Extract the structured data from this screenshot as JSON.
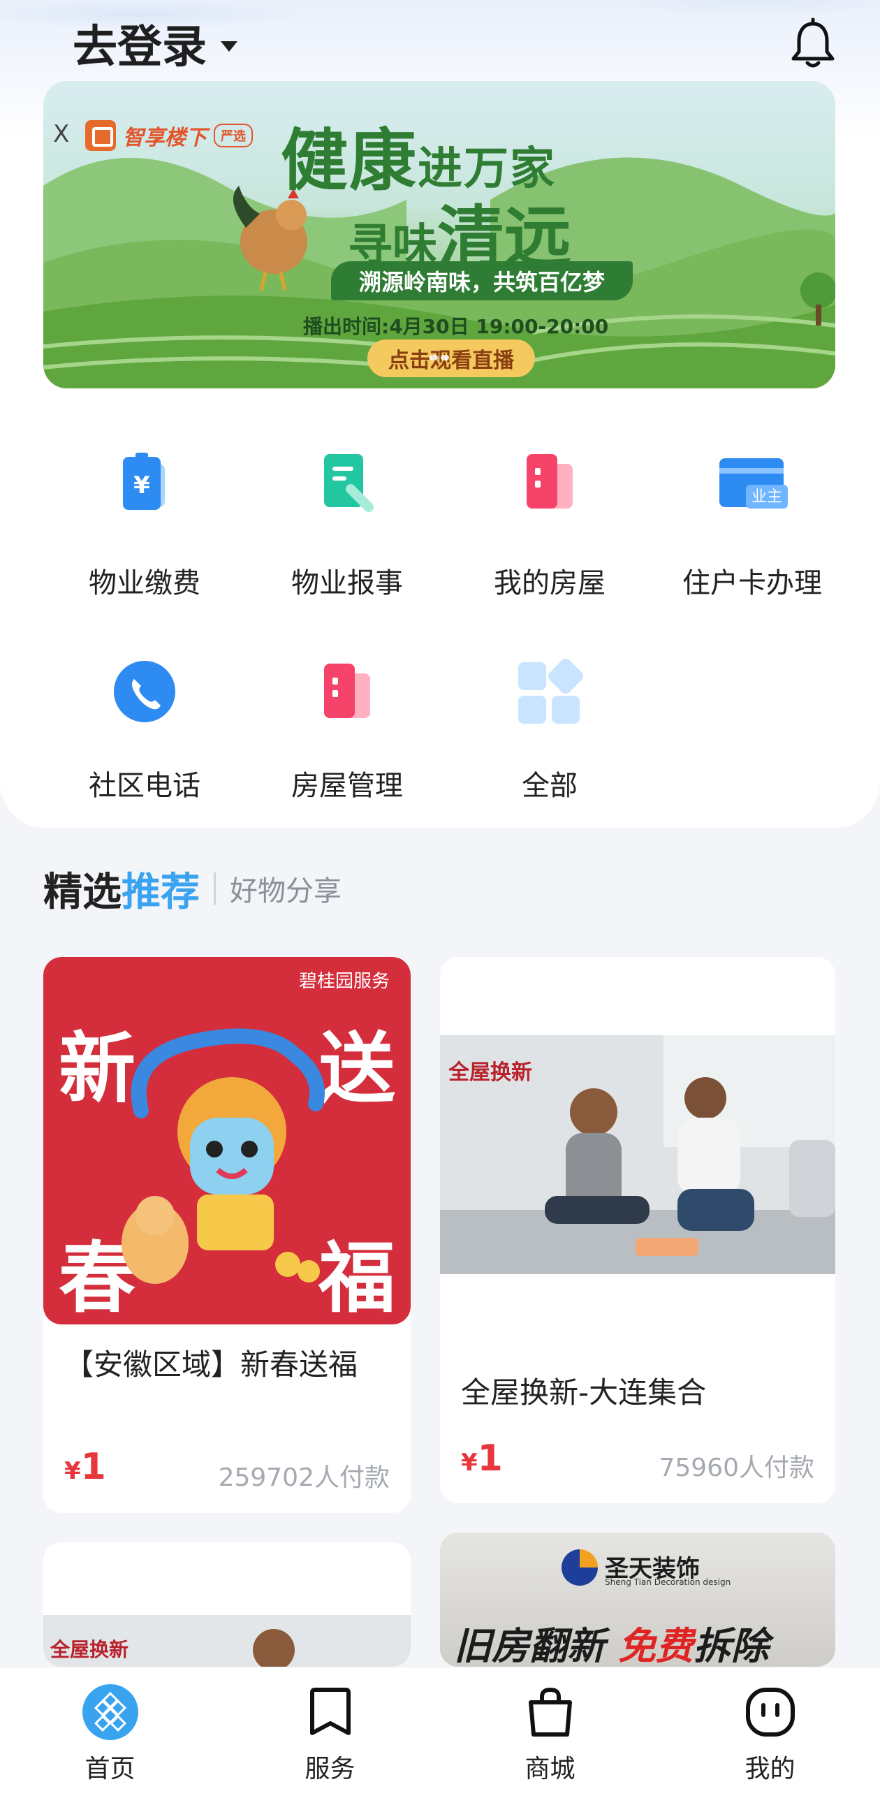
{
  "header": {
    "login_label": "去登录"
  },
  "banner": {
    "close_label": "X",
    "brand": "智享楼下",
    "brand_tag": "严选",
    "title_line1_a": "健康",
    "title_line1_b": "进万家",
    "title_line2_a": "寻味",
    "title_line2_b": "清远",
    "ribbon": "溯源岭南味，共筑百亿梦",
    "time": "播出时间:4月30日 19:00-20:00",
    "button": "点击观看直播"
  },
  "services": [
    {
      "label": "物业缴费",
      "icon": "wallet-icon"
    },
    {
      "label": "物业报事",
      "icon": "report-icon"
    },
    {
      "label": "我的房屋",
      "icon": "building-icon"
    },
    {
      "label": "住户卡办理",
      "icon": "resident-card-icon"
    },
    {
      "label": "社区电话",
      "icon": "phone-icon"
    },
    {
      "label": "房屋管理",
      "icon": "building-manage-icon"
    },
    {
      "label": "全部",
      "icon": "grid-icon"
    }
  ],
  "section": {
    "title_a": "精选",
    "title_b": "推荐",
    "subtitle": "好物分享"
  },
  "products": [
    {
      "title": "【安徽区域】新春送福",
      "price": "1",
      "paid": "259702人付款",
      "img_text_brand": "碧桂园服务",
      "img_text": [
        "新",
        "送",
        "春",
        "福"
      ]
    },
    {
      "title": "全屋换新-大连集合",
      "price": "1",
      "paid": "75960人付款",
      "img_text": "全屋换新"
    },
    {
      "img_text": "全屋换新"
    },
    {
      "img_brand": "圣天装饰",
      "img_brand_en": "Sheng Tian Decoration design",
      "img_text_a": "旧房翻新",
      "img_text_b": "免费",
      "img_text_c": "拆除"
    }
  ],
  "currency": "¥",
  "resident_badge": "业主",
  "tabbar": [
    {
      "label": "首页",
      "icon": "home-logo-icon",
      "active": true
    },
    {
      "label": "服务",
      "icon": "bookmark-icon"
    },
    {
      "label": "商城",
      "icon": "shopping-bag-icon"
    },
    {
      "label": "我的",
      "icon": "smile-face-icon"
    }
  ],
  "colors": {
    "accent": "#3aa3f0",
    "price": "#e8363d",
    "banner_green": "#2e7d32"
  }
}
